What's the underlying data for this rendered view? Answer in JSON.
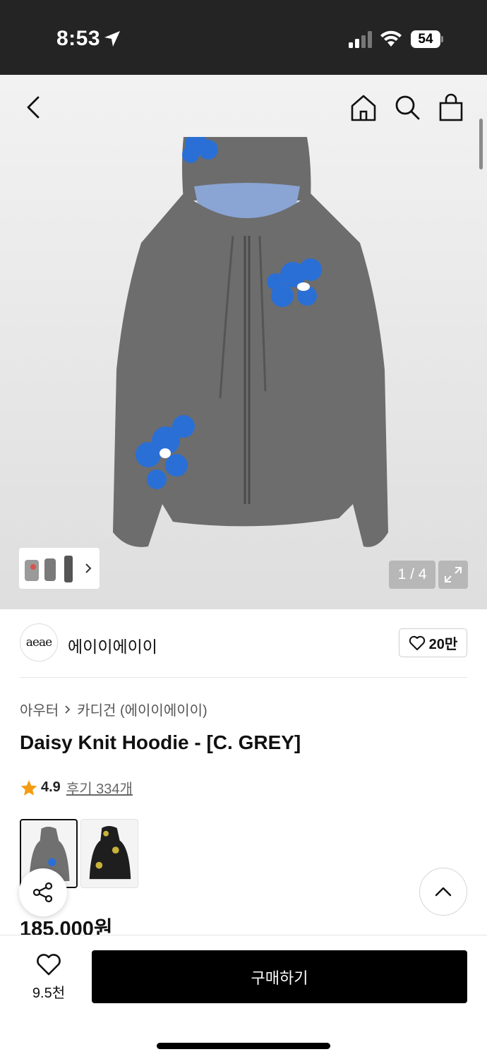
{
  "status_bar": {
    "time": "8:53",
    "battery": "54"
  },
  "hero": {
    "image_counter": "1 / 4"
  },
  "brand": {
    "logo_text": "aeae",
    "name": "에이이에이이",
    "like_count": "20만"
  },
  "breadcrumb": {
    "category": "아우터",
    "subcategory": "카디건 (에이이에이이)"
  },
  "product": {
    "title": "Daisy Knit Hoodie - [C. GREY]",
    "rating": "4.9",
    "reviews": "후기 334개",
    "price": "185,000원"
  },
  "bottom_bar": {
    "wish_count": "9.5천",
    "buy_label": "구매하기"
  },
  "colors": {
    "accent_star": "#f39c12",
    "flower_blue": "#2a6fd6",
    "flower_yellow": "#c9b23a",
    "knit_grey": "#6d6d6d"
  },
  "icons": [
    "location-arrow-icon",
    "signal-icon",
    "wifi-icon",
    "back-arrow-icon",
    "home-icon",
    "search-icon",
    "shopping-bag-icon",
    "chevron-right-icon",
    "expand-icon",
    "heart-icon",
    "star-icon",
    "share-icon",
    "chevron-up-icon"
  ]
}
